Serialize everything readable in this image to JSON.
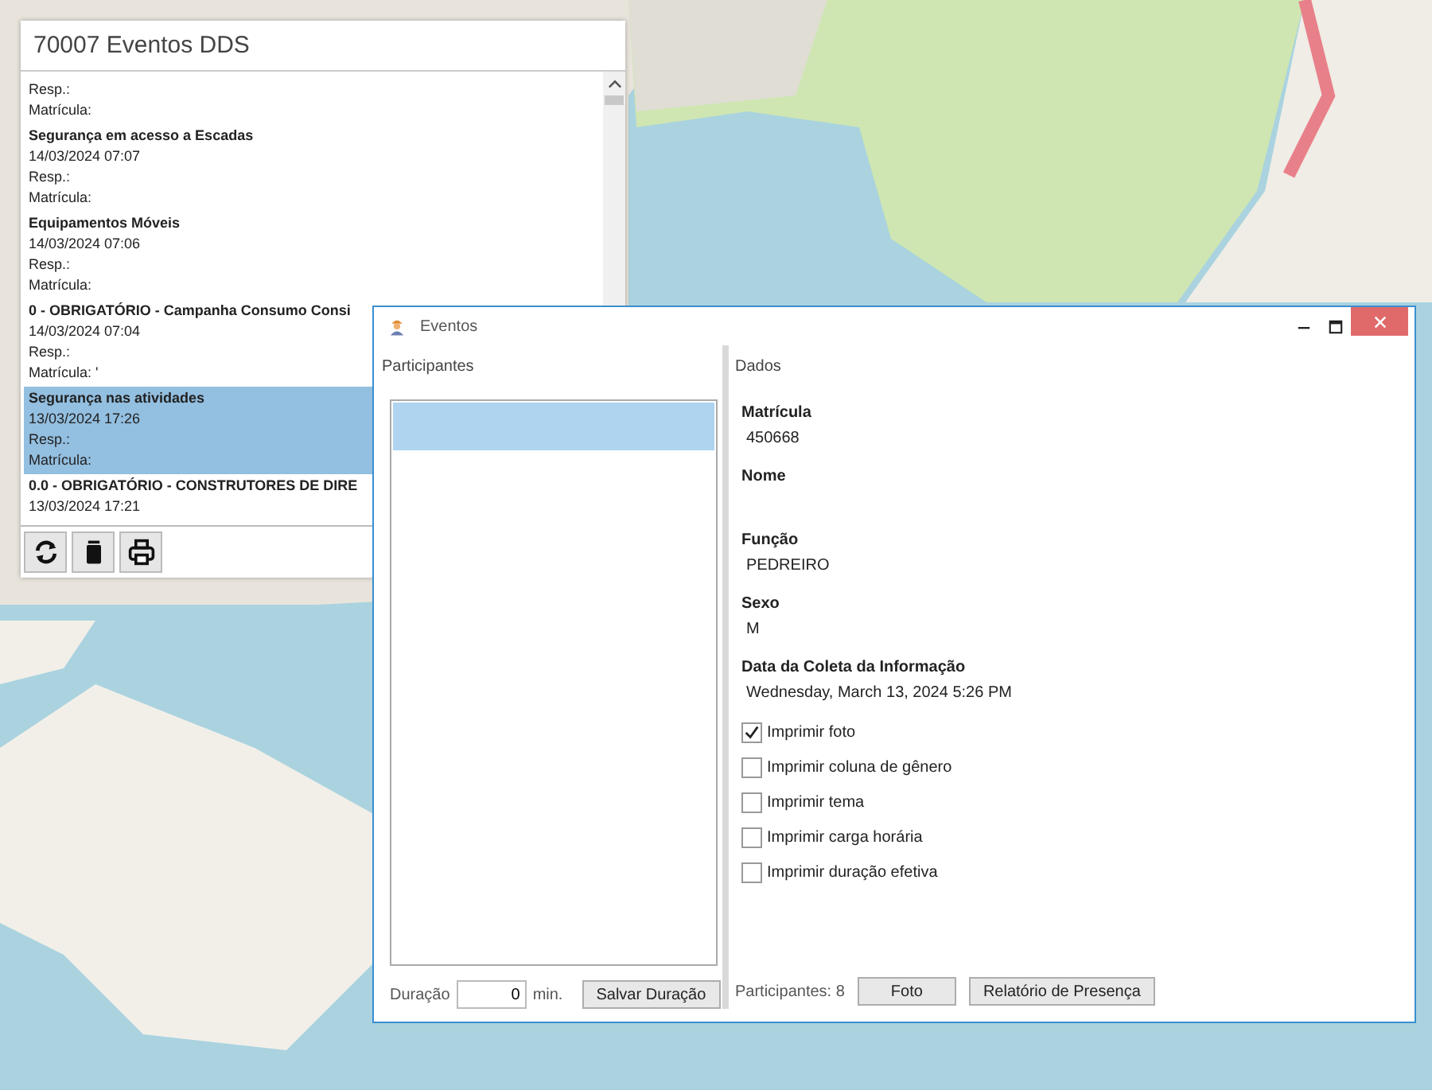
{
  "left_window": {
    "title": "70007 Eventos DDS",
    "events": [
      {
        "resp": "Resp.:",
        "matricula": "Matrícula:",
        "selected": false
      },
      {
        "title": "Segurança em acesso a Escadas",
        "date": "14/03/2024 07:07",
        "resp": "Resp.:",
        "matricula": "Matrícula:",
        "selected": false
      },
      {
        "title": "Equipamentos Móveis",
        "date": "14/03/2024 07:06",
        "resp": "Resp.:",
        "matricula": "Matrícula:",
        "selected": false
      },
      {
        "title": "0 - OBRIGATÓRIO - Campanha Consumo Consi",
        "date": "14/03/2024 07:04",
        "resp": "Resp.:",
        "matricula": "Matrícula: '",
        "selected": false
      },
      {
        "title": "Segurança nas atividades",
        "date": "13/03/2024 17:26",
        "resp": "Resp.:",
        "matricula": "Matrícula:",
        "selected": true
      },
      {
        "title": "0.0 - OBRIGATÓRIO - CONSTRUTORES DE DIRE",
        "date": "13/03/2024 17:21",
        "selected": false
      }
    ]
  },
  "dialog": {
    "title": "Eventos",
    "participants_label": "Participantes",
    "participants": [
      {
        "selected": true
      }
    ],
    "duration_label": "Duração",
    "duration_value": "0",
    "duration_unit": "min.",
    "save_button": "Salvar Duração",
    "data_label": "Dados",
    "fields": [
      {
        "label": "Matrícula",
        "value": "450668"
      },
      {
        "label": "Nome"
      },
      {
        "label": "Função",
        "value": "PEDREIRO"
      },
      {
        "label": "Sexo",
        "value": "M"
      },
      {
        "label": "Data da Coleta da Informação",
        "value": "Wednesday, March 13, 2024 5:26 PM"
      }
    ],
    "options": [
      {
        "label": "Imprimir foto",
        "checked": true
      },
      {
        "label": "Imprimir coluna de gênero",
        "checked": false
      },
      {
        "label": "Imprimir tema",
        "checked": false
      },
      {
        "label": "Imprimir carga horária",
        "checked": false
      },
      {
        "label": "Imprimir duração efetiva",
        "checked": false
      }
    ],
    "participants_count": "Participantes: 8",
    "buttons": [
      "Foto",
      "Relatório de Presença"
    ]
  }
}
